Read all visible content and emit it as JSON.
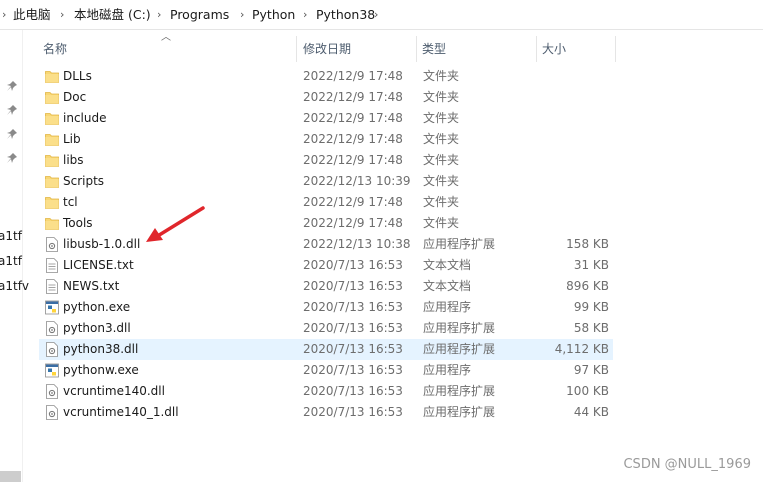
{
  "breadcrumb": {
    "items": [
      "此电脑",
      "本地磁盘 (C:)",
      "Programs",
      "Python",
      "Python38"
    ]
  },
  "columns": {
    "name": "名称",
    "date": "修改日期",
    "type": "类型",
    "size": "大小"
  },
  "nav": {
    "truncated_labels": [
      "a1tf",
      "a1tf",
      "a1tfv"
    ]
  },
  "files": [
    {
      "name": "DLLs",
      "date": "2022/12/9 17:48",
      "type": "文件夹",
      "size": "",
      "icon": "folder-icon"
    },
    {
      "name": "Doc",
      "date": "2022/12/9 17:48",
      "type": "文件夹",
      "size": "",
      "icon": "folder-icon"
    },
    {
      "name": "include",
      "date": "2022/12/9 17:48",
      "type": "文件夹",
      "size": "",
      "icon": "folder-icon"
    },
    {
      "name": "Lib",
      "date": "2022/12/9 17:48",
      "type": "文件夹",
      "size": "",
      "icon": "folder-icon"
    },
    {
      "name": "libs",
      "date": "2022/12/9 17:48",
      "type": "文件夹",
      "size": "",
      "icon": "folder-icon"
    },
    {
      "name": "Scripts",
      "date": "2022/12/13 10:39",
      "type": "文件夹",
      "size": "",
      "icon": "folder-icon"
    },
    {
      "name": "tcl",
      "date": "2022/12/9 17:48",
      "type": "文件夹",
      "size": "",
      "icon": "folder-icon"
    },
    {
      "name": "Tools",
      "date": "2022/12/9 17:48",
      "type": "文件夹",
      "size": "",
      "icon": "folder-icon"
    },
    {
      "name": "libusb-1.0.dll",
      "date": "2022/12/13 10:38",
      "type": "应用程序扩展",
      "size": "158 KB",
      "icon": "dll-file-icon"
    },
    {
      "name": "LICENSE.txt",
      "date": "2020/7/13 16:53",
      "type": "文本文档",
      "size": "31 KB",
      "icon": "text-file-icon"
    },
    {
      "name": "NEWS.txt",
      "date": "2020/7/13 16:53",
      "type": "文本文档",
      "size": "896 KB",
      "icon": "text-file-icon"
    },
    {
      "name": "python.exe",
      "date": "2020/7/13 16:53",
      "type": "应用程序",
      "size": "99 KB",
      "icon": "python-exe-icon"
    },
    {
      "name": "python3.dll",
      "date": "2020/7/13 16:53",
      "type": "应用程序扩展",
      "size": "58 KB",
      "icon": "dll-file-icon"
    },
    {
      "name": "python38.dll",
      "date": "2020/7/13 16:53",
      "type": "应用程序扩展",
      "size": "4,112 KB",
      "icon": "dll-file-icon",
      "selected": true
    },
    {
      "name": "pythonw.exe",
      "date": "2020/7/13 16:53",
      "type": "应用程序",
      "size": "97 KB",
      "icon": "python-exe-icon"
    },
    {
      "name": "vcruntime140.dll",
      "date": "2020/7/13 16:53",
      "type": "应用程序扩展",
      "size": "100 KB",
      "icon": "dll-file-icon"
    },
    {
      "name": "vcruntime140_1.dll",
      "date": "2020/7/13 16:53",
      "type": "应用程序扩展",
      "size": "44 KB",
      "icon": "dll-file-icon"
    }
  ],
  "watermark": "CSDN @NULL_1969",
  "colors": {
    "selection": "#e5f3ff",
    "folder": "#f8d775",
    "annotation_arrow": "#e0262b"
  }
}
